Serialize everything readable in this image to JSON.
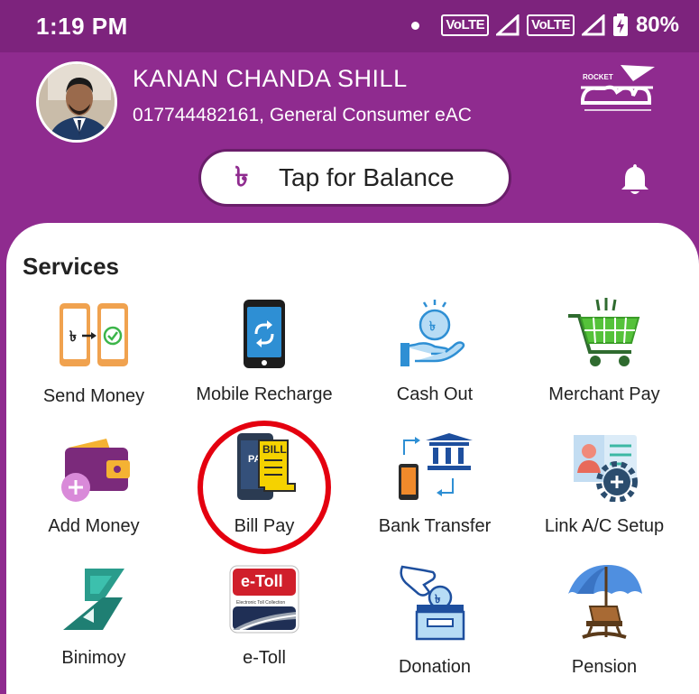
{
  "status_bar": {
    "time": "1:19 PM",
    "volte_1": "VoLTE",
    "volte_2": "VoLTE",
    "battery": "80%"
  },
  "profile": {
    "name": "KANAN CHANDA SHILL",
    "subtitle": "017744482161, General Consumer eAC"
  },
  "balance": {
    "symbol": "৳",
    "label": "Tap for Balance"
  },
  "services": {
    "title": "Services",
    "items": [
      {
        "label": "Send Money",
        "icon": "send-money-icon"
      },
      {
        "label": "Mobile Recharge",
        "icon": "mobile-recharge-icon"
      },
      {
        "label": "Cash Out",
        "icon": "cash-out-icon"
      },
      {
        "label": "Merchant Pay",
        "icon": "merchant-pay-icon"
      },
      {
        "label": "Add Money",
        "icon": "add-money-icon"
      },
      {
        "label": "Bill Pay",
        "icon": "bill-pay-icon"
      },
      {
        "label": "Bank Transfer",
        "icon": "bank-transfer-icon"
      },
      {
        "label": "Link A/C Setup",
        "icon": "link-ac-setup-icon"
      },
      {
        "label": "Binimoy",
        "icon": "binimoy-icon"
      },
      {
        "label": "e-Toll",
        "icon": "e-toll-icon"
      },
      {
        "label": "Donation",
        "icon": "donation-icon"
      },
      {
        "label": "Pension",
        "icon": "pension-icon"
      }
    ]
  },
  "bill_pay_icon_text": {
    "bill": "BILL",
    "pay": "PAY"
  },
  "e_toll_icon_text": {
    "title": "e-Toll",
    "subtitle": "Electronic Toll Collection"
  },
  "colors": {
    "brand_purple": "#8f2b8f",
    "status_bar": "#7d237d",
    "highlight_ring": "#e4000f"
  }
}
